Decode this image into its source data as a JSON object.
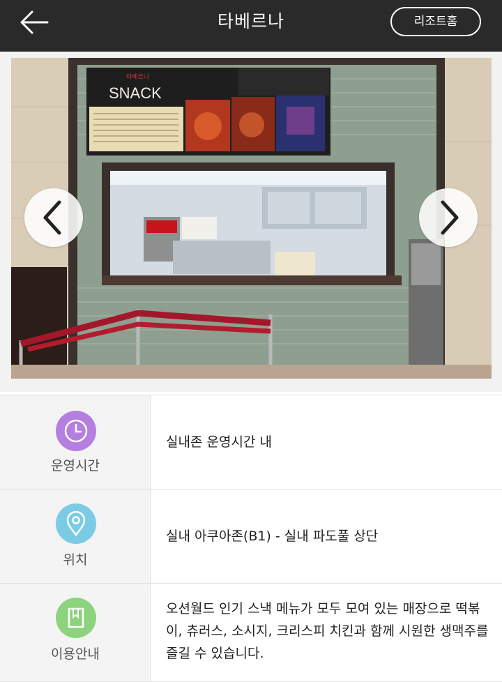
{
  "header": {
    "title": "타베르나",
    "home_button": "리조트홈",
    "back_icon": "arrow-left-icon"
  },
  "gallery": {
    "prev_icon": "chevron-left-icon",
    "next_icon": "chevron-right-icon",
    "sign": {
      "small_text": "타베르나",
      "brand": "SNACK"
    }
  },
  "info": {
    "rows": [
      {
        "icon": "clock-icon",
        "color": "#b57fe0",
        "label": "운영시간",
        "value": "실내존 운영시간 내"
      },
      {
        "icon": "location-pin-icon",
        "color": "#7ccbe5",
        "label": "위치",
        "value": "실내 아쿠아존(B1) - 실내 파도풀 상단"
      },
      {
        "icon": "bookmark-book-icon",
        "color": "#8dd37e",
        "label": "이용안내",
        "value": "오션월드 인기 스낵 메뉴가 모두 모여 있는 매장으로 떡볶이, 츄러스, 소시지, 크리스피 치킨과 함께 시원한 생맥주를 즐길 수 있습니다."
      }
    ]
  }
}
